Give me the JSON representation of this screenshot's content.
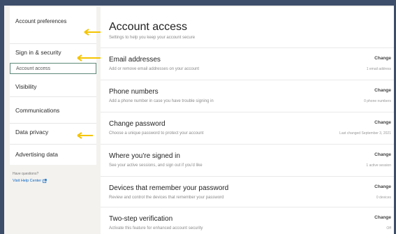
{
  "sidebar": {
    "items": [
      {
        "label": "Account preferences"
      },
      {
        "label": "Sign in & security"
      },
      {
        "label": "Account access"
      },
      {
        "label": "Visibility"
      },
      {
        "label": "Communications"
      },
      {
        "label": "Data privacy"
      },
      {
        "label": "Advertising data"
      }
    ],
    "help_question": "Have questions?",
    "help_link": "Visit Help Center"
  },
  "main": {
    "title": "Account access",
    "subtitle": "Settings to help you keep your account secure",
    "rows": [
      {
        "title": "Email addresses",
        "description": "Add or remove email addresses on your account",
        "action": "Change",
        "meta": "1 email address"
      },
      {
        "title": "Phone numbers",
        "description": "Add a phone number in case you have trouble signing in",
        "action": "Change",
        "meta": "0 phone numbers"
      },
      {
        "title": "Change password",
        "description": "Choose a unique password to protect your account",
        "action": "Change",
        "meta": "Last changed September 3, 2021"
      },
      {
        "title": "Where you're signed in",
        "description": "See your active sessions, and sign out if you'd like",
        "action": "Change",
        "meta": "1 active session"
      },
      {
        "title": "Devices that remember your password",
        "description": "Review and control the devices that remember your password",
        "action": "Change",
        "meta": "0 devices"
      },
      {
        "title": "Two-step verification",
        "description": "Activate this feature for enhanced account security",
        "action": "Change",
        "meta": "Off"
      }
    ]
  },
  "colors": {
    "arrow": "#f5c400",
    "link": "#0a66c2",
    "active_border": "#5f8a7a"
  },
  "icons": {
    "help_link": "external-link-icon",
    "annotation": "arrow-left-icon"
  }
}
